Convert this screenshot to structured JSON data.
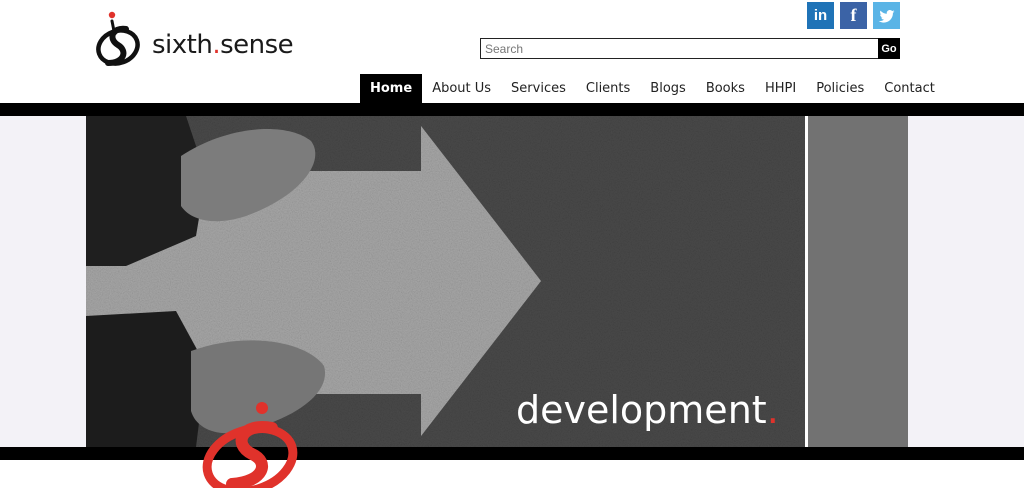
{
  "brand": {
    "name_part1": "sixth",
    "name_dot": ".",
    "name_part2": "sense",
    "accent_color": "#e0322b"
  },
  "social": [
    {
      "name": "linkedin",
      "label": "in",
      "color": "#1f73b7"
    },
    {
      "name": "facebook",
      "label": "f",
      "color": "#3b63a6"
    },
    {
      "name": "twitter",
      "icon": "bird-icon",
      "color": "#5ab4e6"
    }
  ],
  "search": {
    "placeholder": "Search",
    "value": "",
    "button_label": "Go"
  },
  "nav": {
    "items": [
      {
        "label": "Home",
        "active": true
      },
      {
        "label": "About Us"
      },
      {
        "label": "Services"
      },
      {
        "label": "Clients"
      },
      {
        "label": "Blogs"
      },
      {
        "label": "Books"
      },
      {
        "label": "HHPI"
      },
      {
        "label": "Policies"
      },
      {
        "label": "Contact"
      }
    ]
  },
  "hero": {
    "caption_word": "development",
    "caption_dot": "."
  }
}
